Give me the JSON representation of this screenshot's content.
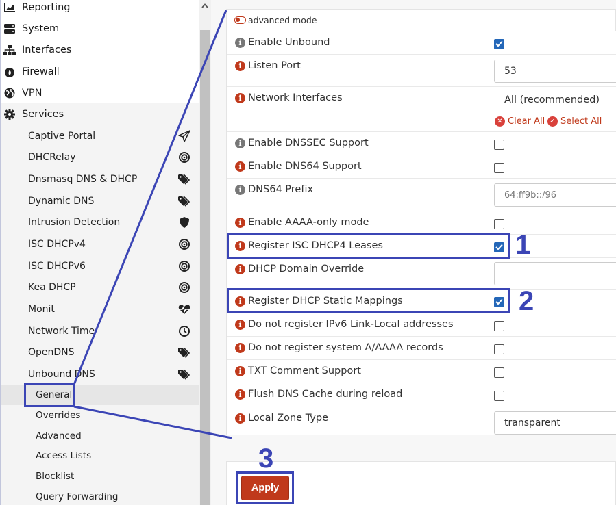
{
  "sidebar": {
    "top_items": [
      {
        "label": "Reporting",
        "icon": "chart-area-icon"
      },
      {
        "label": "System",
        "icon": "server-icon"
      },
      {
        "label": "Interfaces",
        "icon": "sitemap-icon"
      },
      {
        "label": "Firewall",
        "icon": "fire-icon"
      },
      {
        "label": "VPN",
        "icon": "globe-icon"
      },
      {
        "label": "Services",
        "icon": "cogs-icon"
      }
    ],
    "services": [
      {
        "label": "Captive Portal",
        "icon": "paper-plane-icon"
      },
      {
        "label": "DHCRelay",
        "icon": "bullseye-icon"
      },
      {
        "label": "Dnsmasq DNS & DHCP",
        "icon": "tags-icon"
      },
      {
        "label": "Dynamic DNS",
        "icon": "tags-icon"
      },
      {
        "label": "Intrusion Detection",
        "icon": "shield-icon"
      },
      {
        "label": "ISC DHCPv4",
        "icon": "bullseye-icon"
      },
      {
        "label": "ISC DHCPv6",
        "icon": "bullseye-icon"
      },
      {
        "label": "Kea DHCP",
        "icon": "bullseye-icon"
      },
      {
        "label": "Monit",
        "icon": "heartbeat-icon"
      },
      {
        "label": "Network Time",
        "icon": "clock-icon"
      },
      {
        "label": "OpenDNS",
        "icon": "tags-icon"
      },
      {
        "label": "Unbound DNS",
        "icon": "tags-icon"
      }
    ],
    "unbound_sub": [
      {
        "label": "General",
        "active": true
      },
      {
        "label": "Overrides",
        "active": false
      },
      {
        "label": "Advanced",
        "active": false
      },
      {
        "label": "Access Lists",
        "active": false
      },
      {
        "label": "Blocklist",
        "active": false
      },
      {
        "label": "Query Forwarding",
        "active": false
      }
    ]
  },
  "form": {
    "advanced_mode": "advanced mode",
    "rows": [
      {
        "label": "Enable Unbound",
        "info": "grey",
        "control": "checkbox",
        "checked": true
      },
      {
        "label": "Listen Port",
        "info": "red",
        "control": "input",
        "value": "53"
      },
      {
        "label": "Network Interfaces",
        "info": "red",
        "control": "select",
        "value": "All (recommended)"
      },
      {
        "label": "Enable DNSSEC Support",
        "info": "grey",
        "control": "checkbox",
        "checked": false
      },
      {
        "label": "Enable DNS64 Support",
        "info": "red",
        "control": "checkbox",
        "checked": false
      },
      {
        "label": "DNS64 Prefix",
        "info": "grey",
        "control": "input",
        "placeholder": "64:ff9b::/96"
      },
      {
        "label": "Enable AAAA-only mode",
        "info": "red",
        "control": "checkbox",
        "checked": false
      },
      {
        "label": "Register ISC DHCP4 Leases",
        "info": "red",
        "control": "checkbox",
        "checked": true
      },
      {
        "label": "DHCP Domain Override",
        "info": "red",
        "control": "input",
        "value": ""
      },
      {
        "label": "Register DHCP Static Mappings",
        "info": "red",
        "control": "checkbox",
        "checked": true
      },
      {
        "label": "Do not register IPv6 Link-Local addresses",
        "info": "red",
        "control": "checkbox",
        "checked": false
      },
      {
        "label": "Do not register system A/AAAA records",
        "info": "red",
        "control": "checkbox",
        "checked": false
      },
      {
        "label": "TXT Comment Support",
        "info": "red",
        "control": "checkbox",
        "checked": false
      },
      {
        "label": "Flush DNS Cache during reload",
        "info": "red",
        "control": "checkbox",
        "checked": false
      },
      {
        "label": "Local Zone Type",
        "info": "red",
        "control": "select",
        "value": "transparent"
      }
    ],
    "clear_all": "Clear All",
    "select_all": "Select All",
    "apply_label": "Apply"
  },
  "annotations": {
    "num1": "1",
    "num2": "2",
    "num3": "3"
  },
  "colors": {
    "accent": "#c0391b",
    "checkbox": "#2467b8",
    "annotation": "#3b45b5"
  }
}
